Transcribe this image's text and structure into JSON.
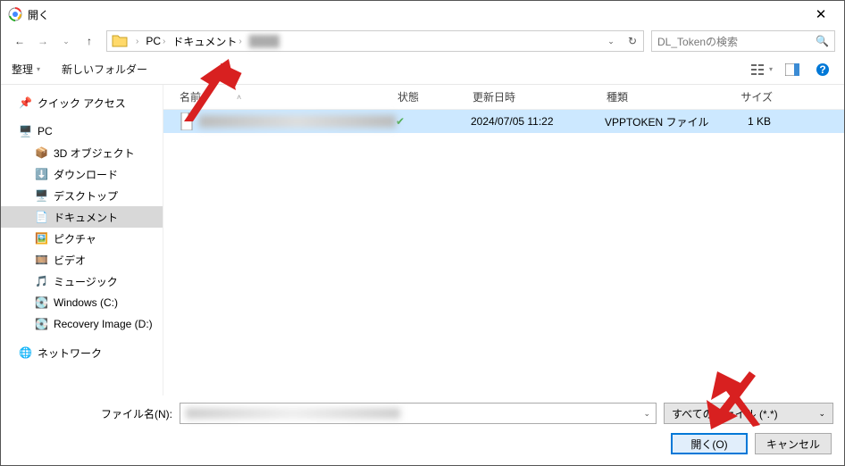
{
  "title": "開く",
  "nav": {
    "back": "←",
    "forward": "→",
    "up": "↑"
  },
  "breadcrumb": {
    "root": "PC",
    "folder": "ドキュメント"
  },
  "search": {
    "placeholder": "DL_Tokenの検索"
  },
  "toolbar": {
    "organize": "整理",
    "newfolder": "新しいフォルダー"
  },
  "sidebar": {
    "quick": "クイック アクセス",
    "pc": "PC",
    "items": [
      "3D オブジェクト",
      "ダウンロード",
      "デスクトップ",
      "ドキュメント",
      "ピクチャ",
      "ビデオ",
      "ミュージック",
      "Windows (C:)",
      "Recovery Image (D:)"
    ],
    "network": "ネットワーク"
  },
  "columns": {
    "name": "名前",
    "status": "状態",
    "date": "更新日時",
    "type": "種類",
    "size": "サイズ"
  },
  "file": {
    "date": "2024/07/05 11:22",
    "type": "VPPTOKEN ファイル",
    "size": "1 KB"
  },
  "bottom": {
    "filename_label": "ファイル名(N):",
    "filter": "すべてのファイル (*.*)",
    "open": "開く(O)",
    "cancel": "キャンセル"
  }
}
